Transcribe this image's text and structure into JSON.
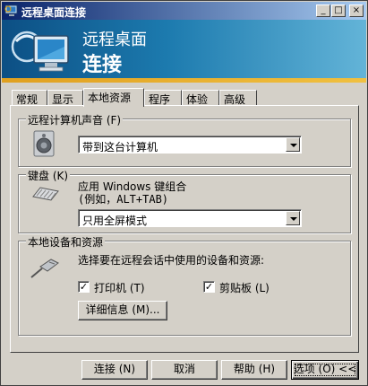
{
  "window": {
    "title": "远程桌面连接",
    "minimize_glyph": "_",
    "maximize_glyph": "□",
    "close_glyph": "×"
  },
  "banner": {
    "line1": "远程桌面",
    "line2": "连接"
  },
  "tabs": [
    {
      "label": "常规",
      "active": false
    },
    {
      "label": "显示",
      "active": false
    },
    {
      "label": "本地资源",
      "active": true
    },
    {
      "label": "程序",
      "active": false
    },
    {
      "label": "体验",
      "active": false
    },
    {
      "label": "高级",
      "active": false
    }
  ],
  "sound": {
    "group_title": "远程计算机声音 (F)",
    "selected": "带到这台计算机",
    "icon": "speaker-icon"
  },
  "keyboard": {
    "group_title": "键盘 (K)",
    "desc_line1": "应用 Windows 键组合",
    "desc_line2": "(例如，ALT+TAB)",
    "selected": "只用全屏模式",
    "icon": "keyboard-icon"
  },
  "local_devices": {
    "group_title": "本地设备和资源",
    "desc": "选择要在远程会话中使用的设备和资源:",
    "printer_label": "打印机 (T)",
    "printer_checked": true,
    "clipboard_label": "剪贴板 (L)",
    "clipboard_checked": true,
    "details_button": "详细信息 (M)...",
    "icon": "usb-plug-icon"
  },
  "footer": {
    "connect": "连接 (N)",
    "cancel": "取消",
    "help": "帮助 (H)",
    "options": "选项 (O) <<"
  },
  "colors": {
    "titlebar_start": "#0a246a",
    "titlebar_end": "#a6caf0",
    "banner_start": "#0c4f84",
    "banner_end": "#63b4d8",
    "face": "#d4d0c8"
  }
}
